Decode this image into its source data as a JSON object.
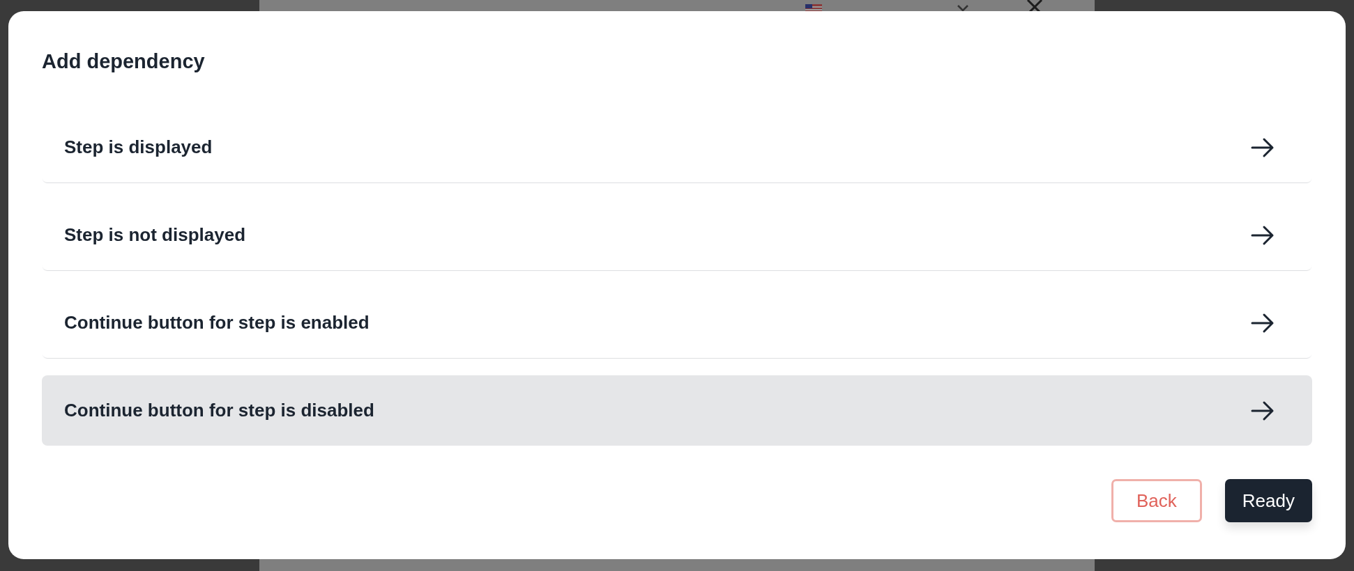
{
  "dialog": {
    "title": "Add dependency",
    "options": [
      {
        "label": "Step is displayed",
        "selected": false
      },
      {
        "label": "Step is not displayed",
        "selected": false
      },
      {
        "label": "Continue button for step is enabled",
        "selected": false
      },
      {
        "label": "Continue button for step is disabled",
        "selected": true
      }
    ],
    "buttons": [
      {
        "label": "Back",
        "kind": "secondary"
      },
      {
        "label": "Ready",
        "kind": "primary"
      }
    ]
  }
}
